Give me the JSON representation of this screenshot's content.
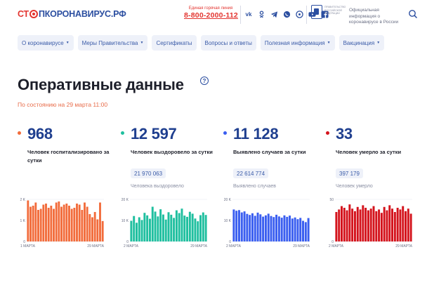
{
  "header": {
    "logo_prefix": "СТ",
    "logo_suffix": "ПКОРОНАВИРУС.РФ",
    "hotline_caption": "Единая горячая линия",
    "hotline_number": "8-800-2000-112",
    "gov_small_text": "ПРАВИТЕЛЬСТВО РОССИЙСКОЙ ФЕДЕРАЦИИ",
    "official_text": "Официальная информация о коронавирусе в России",
    "socials": [
      "vk-icon",
      "odnoklassniki-icon",
      "telegram-icon",
      "viber-icon",
      "messenger-icon",
      "youtube-icon",
      "facebook-icon"
    ]
  },
  "nav": {
    "items": [
      {
        "label": "О коронавирусе",
        "dropdown": true
      },
      {
        "label": "Меры Правительства",
        "dropdown": true
      },
      {
        "label": "Сертификаты",
        "dropdown": false
      },
      {
        "label": "Вопросы и ответы",
        "dropdown": false
      },
      {
        "label": "Полезная информация",
        "dropdown": true
      },
      {
        "label": "Вакцинация",
        "dropdown": true
      }
    ]
  },
  "main": {
    "title": "Оперативные данные",
    "help_glyph": "?",
    "status": "По состоянию на 29 марта 11:00"
  },
  "stats": [
    {
      "value": "968",
      "label": "Человек госпитализировано за сутки",
      "total": "",
      "total_label": "",
      "color": "#f26b3a",
      "chart_max": 2000,
      "y_ticks": [
        "2 K",
        "1 K",
        "0"
      ],
      "x_start": "1 МАРТА",
      "x_end": "29 МАРТА",
      "bars": [
        1950,
        1650,
        1700,
        1850,
        1500,
        1550,
        1750,
        1800,
        1600,
        1700,
        1550,
        1850,
        1900,
        1650,
        1750,
        1800,
        1700,
        1550,
        1600,
        1800,
        1750,
        1500,
        1850,
        1650,
        1300,
        1150,
        1400,
        1050,
        1850,
        968
      ]
    },
    {
      "value": "12 597",
      "label": "Человек выздоровело за сутки",
      "total": "21 970 063",
      "total_label": "Человека выздоровело",
      "color": "#1fbf9f",
      "chart_max": 20000,
      "y_ticks": [
        "20 K",
        "10 K",
        "0"
      ],
      "x_start": "2 МАРТА",
      "x_end": "29 МАРТА",
      "bars": [
        9800,
        12100,
        8900,
        11500,
        10200,
        13600,
        12400,
        10800,
        16500,
        14200,
        11900,
        15300,
        12800,
        10400,
        13900,
        12700,
        11200,
        14800,
        13500,
        15600,
        12300,
        11700,
        14100,
        13200,
        10900,
        9600,
        12500,
        13800,
        12597
      ]
    },
    {
      "value": "11 128",
      "label": "Выявлено случаев за сутки",
      "total": "22 614 774",
      "total_label": "Выявлено случаев",
      "color": "#3a5ef0",
      "chart_max": 20000,
      "y_ticks": [
        "20 K",
        "10 K",
        "0"
      ],
      "x_start": "2 МАРТА",
      "x_end": "29 МАРТА",
      "bars": [
        15200,
        14600,
        14900,
        13800,
        14300,
        13100,
        12600,
        13400,
        12200,
        13700,
        12900,
        11800,
        12400,
        13200,
        12100,
        11600,
        12700,
        11900,
        11300,
        12400,
        11700,
        12300,
        10900,
        11400,
        10600,
        11200,
        9800,
        9200,
        11128
      ]
    },
    {
      "value": "33",
      "label": "Человек умерло за сутки",
      "total": "397 179",
      "total_label": "Человек умерло",
      "color": "#d4131c",
      "chart_max": 50,
      "y_ticks": [
        "50",
        "",
        "0"
      ],
      "x_start": "2 МАРТА",
      "x_end": "29 МАРТА",
      "bars": [
        35,
        38,
        42,
        40,
        37,
        44,
        39,
        36,
        41,
        38,
        43,
        40,
        37,
        39,
        42,
        36,
        38,
        34,
        41,
        37,
        43,
        39,
        35,
        40,
        38,
        42,
        36,
        39,
        33
      ]
    }
  ],
  "chart_data": [
    {
      "type": "bar",
      "series": [
        {
          "values": [
            1950,
            1650,
            1700,
            1850,
            1500,
            1550,
            1750,
            1800,
            1600,
            1700,
            1550,
            1850,
            1900,
            1650,
            1750,
            1800,
            1700,
            1550,
            1600,
            1800,
            1750,
            1500,
            1850,
            1650,
            1300,
            1150,
            1400,
            1050,
            1850,
            968
          ]
        }
      ],
      "ylim": [
        0,
        2000
      ],
      "xlabel": "",
      "ylabel": "",
      "title": ""
    },
    {
      "type": "bar",
      "series": [
        {
          "values": [
            9800,
            12100,
            8900,
            11500,
            10200,
            13600,
            12400,
            10800,
            16500,
            14200,
            11900,
            15300,
            12800,
            10400,
            13900,
            12700,
            11200,
            14800,
            13500,
            15600,
            12300,
            11700,
            14100,
            13200,
            10900,
            9600,
            12500,
            13800,
            12597
          ]
        }
      ],
      "ylim": [
        0,
        20000
      ],
      "xlabel": "",
      "ylabel": "",
      "title": ""
    },
    {
      "type": "bar",
      "series": [
        {
          "values": [
            15200,
            14600,
            14900,
            13800,
            14300,
            13100,
            12600,
            13400,
            12200,
            13700,
            12900,
            11800,
            12400,
            13200,
            12100,
            11600,
            12700,
            11900,
            11300,
            12400,
            11700,
            12300,
            10900,
            11400,
            10600,
            11200,
            9800,
            9200,
            11128
          ]
        }
      ],
      "ylim": [
        0,
        20000
      ],
      "xlabel": "",
      "ylabel": "",
      "title": ""
    },
    {
      "type": "bar",
      "series": [
        {
          "values": [
            35,
            38,
            42,
            40,
            37,
            44,
            39,
            36,
            41,
            38,
            43,
            40,
            37,
            39,
            42,
            36,
            38,
            34,
            41,
            37,
            43,
            39,
            35,
            40,
            38,
            42,
            36,
            39,
            33
          ]
        }
      ],
      "ylim": [
        0,
        50
      ],
      "xlabel": "",
      "ylabel": "",
      "title": ""
    }
  ]
}
